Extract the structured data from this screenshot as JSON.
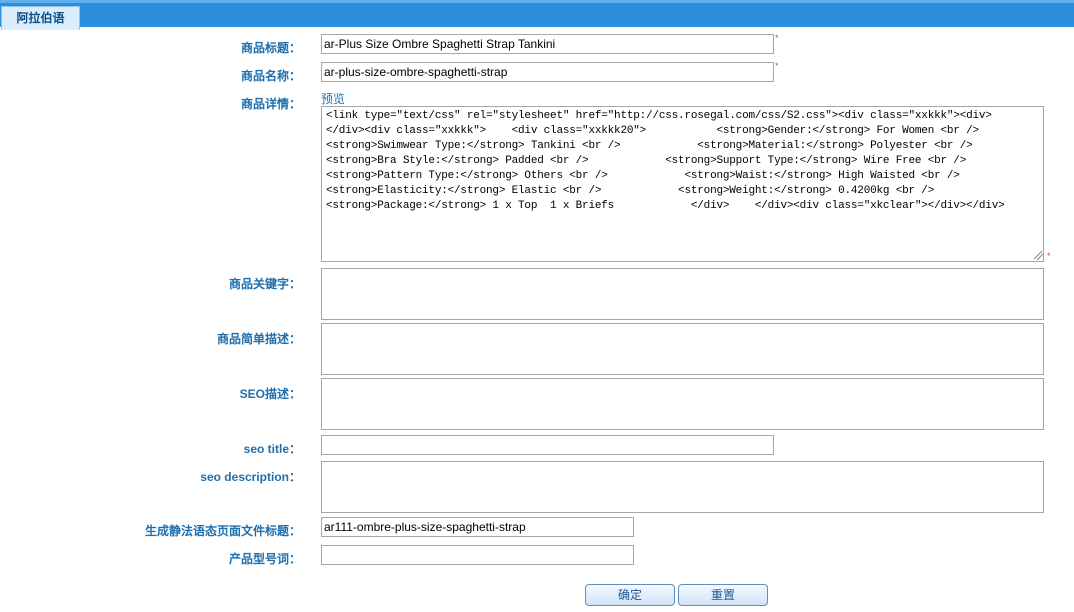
{
  "tab": {
    "label": "阿拉伯语"
  },
  "form": {
    "title": {
      "label": "商品标题：",
      "value": "ar-Plus Size Ombre Spaghetti Strap Tankini"
    },
    "name": {
      "label": "商品名称：",
      "value": "ar-plus-size-ombre-spaghetti-strap"
    },
    "detail": {
      "label": "商品详情：",
      "preview_link": "预览",
      "code": "<link type=\"text/css\" rel=\"stylesheet\" href=\"http://css.rosegal.com/css/S2.css\"><div class=\"xxkkk\"><div>\n</div><div class=\"xxkkk\">    <div class=\"xxkkk20\">           <strong>Gender:</strong> For Women <br />\n<strong>Swimwear Type:</strong> Tankini <br />            <strong>Material:</strong> Polyester <br />\n<strong>Bra Style:</strong> Padded <br />            <strong>Support Type:</strong> Wire Free <br />\n<strong>Pattern Type:</strong> Others <br />            <strong>Waist:</strong> High Waisted <br />\n<strong>Elasticity:</strong> Elastic <br />            <strong>Weight:</strong> 0.4200kg <br />\n<strong>Package:</strong> 1 x Top  1 x Briefs            </div>    </div><div class=\"xkclear\"></div></div>"
    },
    "keywords": {
      "label": "商品关键字：",
      "value": ""
    },
    "short_desc": {
      "label": "商品简单描述：",
      "value": ""
    },
    "seo_desc": {
      "label": "SEO描述：",
      "value": ""
    },
    "seo_title": {
      "label": "seo title：",
      "value": ""
    },
    "seo_description": {
      "label": "seo description：",
      "value": ""
    },
    "static_title": {
      "label": "生成静法语态页面文件标题：",
      "value": "ar111-ombre-plus-size-spaghetti-strap"
    },
    "model_word": {
      "label": "产品型号词：",
      "value": ""
    },
    "required_mark": "*"
  },
  "buttons": {
    "confirm": "确定",
    "reset": "重置"
  }
}
